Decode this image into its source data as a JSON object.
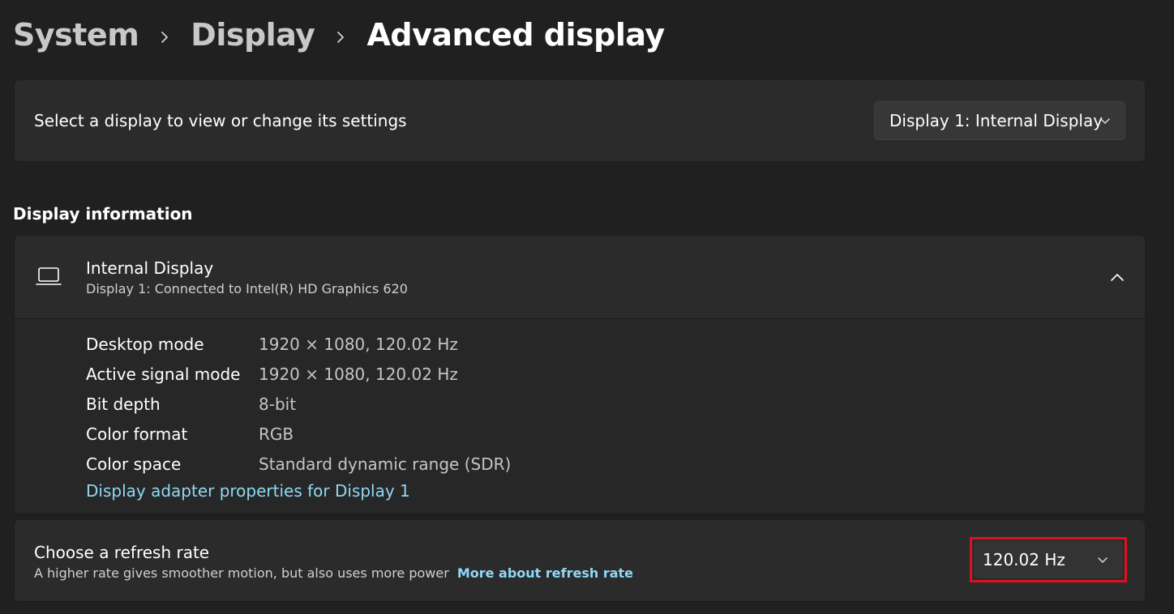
{
  "breadcrumb": {
    "items": [
      "System",
      "Display"
    ],
    "current": "Advanced display"
  },
  "select_display": {
    "label": "Select a display to view or change its settings",
    "dropdown_value": "Display 1: Internal Display"
  },
  "display_information": {
    "section_title": "Display information",
    "header": {
      "title": "Internal Display",
      "subtitle": "Display 1: Connected to Intel(R) HD Graphics 620"
    },
    "rows": [
      {
        "key": "Desktop mode",
        "value": "1920 × 1080, 120.02 Hz"
      },
      {
        "key": "Active signal mode",
        "value": "1920 × 1080, 120.02 Hz"
      },
      {
        "key": "Bit depth",
        "value": "8-bit"
      },
      {
        "key": "Color format",
        "value": "RGB"
      },
      {
        "key": "Color space",
        "value": "Standard dynamic range (SDR)"
      }
    ],
    "adapter_link": "Display adapter properties for Display 1"
  },
  "refresh_rate": {
    "title": "Choose a refresh rate",
    "description": "A higher rate gives smoother motion, but also uses more power",
    "more_link": "More about refresh rate",
    "dropdown_value": "120.02 Hz",
    "highlight_color": "#e0101e"
  },
  "icons": {
    "breadcrumb_separator": "chevron-right-icon",
    "dropdown": "chevron-down-icon",
    "collapse": "chevron-up-icon",
    "device": "laptop-icon"
  },
  "colors": {
    "background": "#202020",
    "card": "#2b2b2b",
    "link": "#8fd8f5"
  }
}
